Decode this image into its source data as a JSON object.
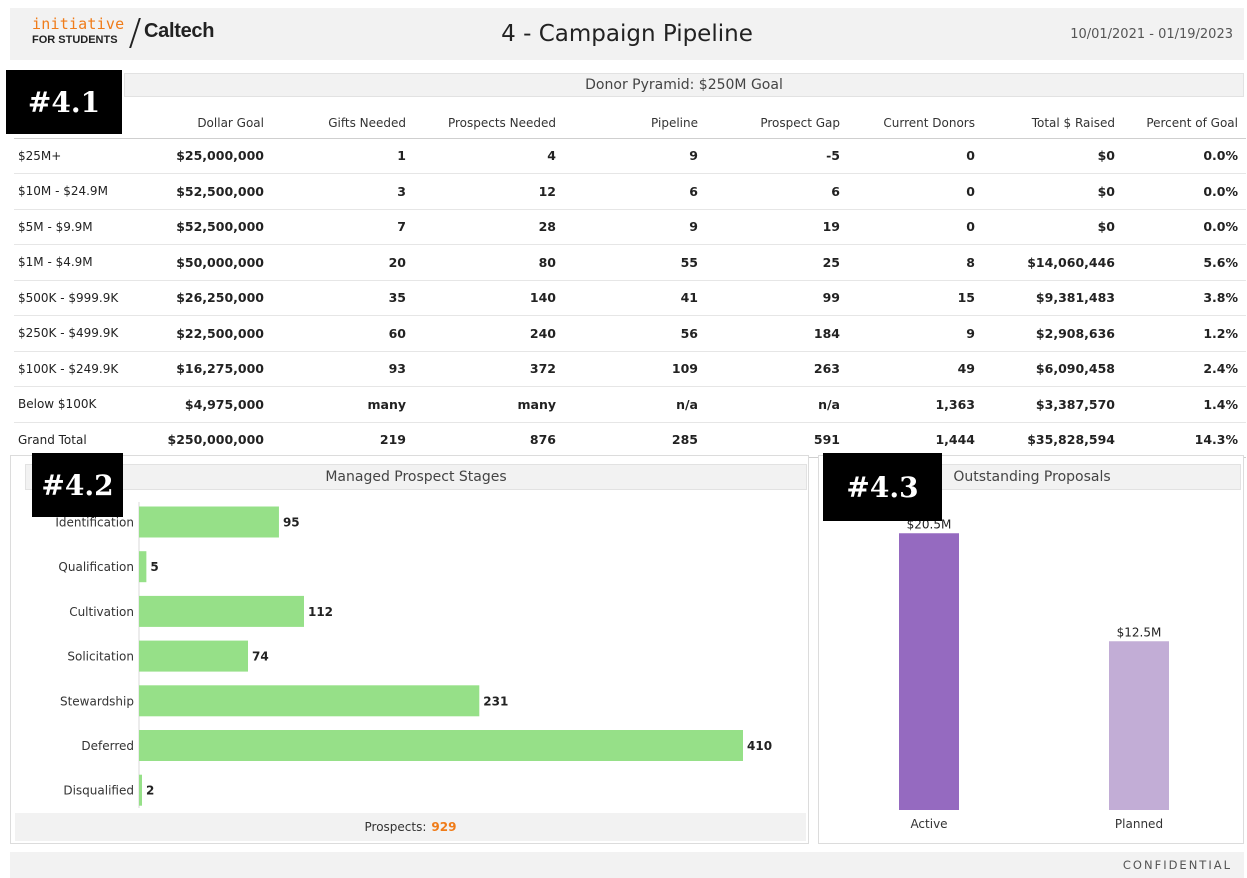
{
  "header": {
    "logo_top": "initiative",
    "logo_bottom": "FOR STUDENTS",
    "logo_caltech": "Caltech",
    "title": "4 - Campaign Pipeline",
    "date_range": "10/01/2021 - 01/19/2023"
  },
  "badges": {
    "b1": "#4.1",
    "b2": "#4.2",
    "b3": "#4.3"
  },
  "pyramid": {
    "title": "Donor Pyramid: $250M Goal",
    "columns": [
      "",
      "Dollar Goal",
      "Gifts Needed",
      "Prospects Needed",
      "Pipeline",
      "Prospect Gap",
      "Current Donors",
      "Total $ Raised",
      "Percent of Goal"
    ],
    "rows": [
      [
        "$25M+",
        "$25,000,000",
        "1",
        "4",
        "9",
        "-5",
        "0",
        "$0",
        "0.0%"
      ],
      [
        "$10M - $24.9M",
        "$52,500,000",
        "3",
        "12",
        "6",
        "6",
        "0",
        "$0",
        "0.0%"
      ],
      [
        "$5M - $9.9M",
        "$52,500,000",
        "7",
        "28",
        "9",
        "19",
        "0",
        "$0",
        "0.0%"
      ],
      [
        "$1M - $4.9M",
        "$50,000,000",
        "20",
        "80",
        "55",
        "25",
        "8",
        "$14,060,446",
        "5.6%"
      ],
      [
        "$500K - $999.9K",
        "$26,250,000",
        "35",
        "140",
        "41",
        "99",
        "15",
        "$9,381,483",
        "3.8%"
      ],
      [
        "$250K - $499.9K",
        "$22,500,000",
        "60",
        "240",
        "56",
        "184",
        "9",
        "$2,908,636",
        "1.2%"
      ],
      [
        "$100K - $249.9K",
        "$16,275,000",
        "93",
        "372",
        "109",
        "263",
        "49",
        "$6,090,458",
        "2.4%"
      ],
      [
        "Below $100K",
        "$4,975,000",
        "many",
        "many",
        "n/a",
        "n/a",
        "1,363",
        "$3,387,570",
        "1.4%"
      ]
    ],
    "total": [
      "Grand Total",
      "$250,000,000",
      "219",
      "876",
      "285",
      "591",
      "1,444",
      "$35,828,594",
      "14.3%"
    ]
  },
  "chart_data": [
    {
      "type": "bar",
      "orientation": "horizontal",
      "title": "Managed Prospect Stages",
      "categories": [
        "Identification",
        "Qualification",
        "Cultivation",
        "Solicitation",
        "Stewardship",
        "Deferred",
        "Disqualified"
      ],
      "values": [
        95,
        5,
        112,
        74,
        231,
        410,
        2
      ],
      "color": "#96e088",
      "footer_label": "Prospects:",
      "footer_value": "929"
    },
    {
      "type": "bar",
      "title": "Outstanding Proposals",
      "categories": [
        "Active",
        "Planned"
      ],
      "values": [
        20.5,
        12.5
      ],
      "value_labels": [
        "$20.5M",
        "$12.5M"
      ],
      "colors": [
        "#956ac0",
        "#c2add6"
      ]
    }
  ],
  "footer": {
    "confidential": "CONFIDENTIAL"
  }
}
